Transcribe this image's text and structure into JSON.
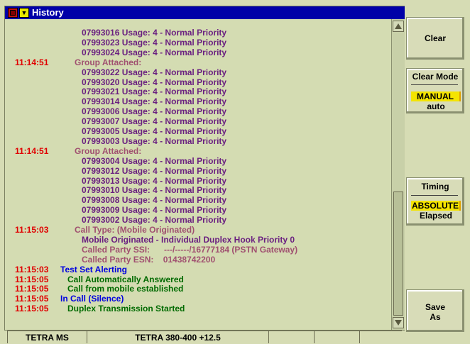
{
  "window": {
    "title": "History",
    "menu_glyph": "▼"
  },
  "colors": {
    "time": "#e00000",
    "event_purple": "#a05070",
    "detail_purple": "#6a2080",
    "blue": "#0000e0",
    "green": "#006a00",
    "highlight": "#f4e400",
    "titlebar": "#0000a8"
  },
  "log": [
    {
      "time": "",
      "text": "07993016 Usage: 4 - Normal Priority",
      "kind": "detail"
    },
    {
      "time": "",
      "text": "07993023 Usage: 4 - Normal Priority",
      "kind": "detail"
    },
    {
      "time": "",
      "text": "07993024 Usage: 4 - Normal Priority",
      "kind": "detail"
    },
    {
      "time": "11:14:51",
      "text": "Group Attached:",
      "kind": "event"
    },
    {
      "time": "",
      "text": "07993022 Usage: 4 - Normal Priority",
      "kind": "detail"
    },
    {
      "time": "",
      "text": "07993020 Usage: 4 - Normal Priority",
      "kind": "detail"
    },
    {
      "time": "",
      "text": "07993021 Usage: 4 - Normal Priority",
      "kind": "detail"
    },
    {
      "time": "",
      "text": "07993014 Usage: 4 - Normal Priority",
      "kind": "detail"
    },
    {
      "time": "",
      "text": "07993006 Usage: 4 - Normal Priority",
      "kind": "detail"
    },
    {
      "time": "",
      "text": "07993007 Usage: 4 - Normal Priority",
      "kind": "detail"
    },
    {
      "time": "",
      "text": "07993005 Usage: 4 - Normal Priority",
      "kind": "detail"
    },
    {
      "time": "",
      "text": "07993003 Usage: 4 - Normal Priority",
      "kind": "detail"
    },
    {
      "time": "11:14:51",
      "text": "Group Attached:",
      "kind": "event"
    },
    {
      "time": "",
      "text": "07993004 Usage: 4 - Normal Priority",
      "kind": "detail"
    },
    {
      "time": "",
      "text": "07993012 Usage: 4 - Normal Priority",
      "kind": "detail"
    },
    {
      "time": "",
      "text": "07993013 Usage: 4 - Normal Priority",
      "kind": "detail"
    },
    {
      "time": "",
      "text": "07993010 Usage: 4 - Normal Priority",
      "kind": "detail"
    },
    {
      "time": "",
      "text": "07993008 Usage: 4 - Normal Priority",
      "kind": "detail"
    },
    {
      "time": "",
      "text": "07993009 Usage: 4 - Normal Priority",
      "kind": "detail"
    },
    {
      "time": "",
      "text": "07993002 Usage: 4 - Normal Priority",
      "kind": "detail"
    },
    {
      "time": "11:15:03",
      "text": "Call Type: (Mobile Originated)",
      "kind": "event"
    },
    {
      "time": "",
      "text": "Mobile Originated - Individual Duplex Hook Priority 0",
      "kind": "detail"
    },
    {
      "time": "",
      "text": "Called Party SSI:      ---/-----/16777184 (PSTN Gateway)",
      "kind": "kv"
    },
    {
      "time": "",
      "text": "Called Party ESN:    01438742200",
      "kind": "kv"
    },
    {
      "time": "11:15:03",
      "text": "Test Set Alerting",
      "kind": "blue"
    },
    {
      "time": "11:15:05",
      "text": "Call Automatically Answered",
      "kind": "green"
    },
    {
      "time": "11:15:05",
      "text": "Call from mobile established",
      "kind": "green"
    },
    {
      "time": "11:15:05",
      "text": "In Call (Silence)",
      "kind": "blue"
    },
    {
      "time": "11:15:05",
      "text": "Duplex Transmission Started",
      "kind": "green"
    }
  ],
  "scroll": {
    "thumb_start": 0.56,
    "thumb_end": 1.0
  },
  "softkeys": {
    "clear": "Clear",
    "clear_mode": {
      "title": "Clear Mode",
      "options": [
        "MANUAL",
        "auto"
      ],
      "selected": 0
    },
    "timing": {
      "title": "Timing",
      "options": [
        "ABSOLUTE",
        "Elapsed"
      ],
      "selected": 0
    },
    "save_line1": "Save",
    "save_line2": "As"
  },
  "status": {
    "mode": "TETRA MS",
    "band": "TETRA 380-400 +12.5",
    "cell3": "",
    "cell4": "",
    "cell5": ""
  }
}
